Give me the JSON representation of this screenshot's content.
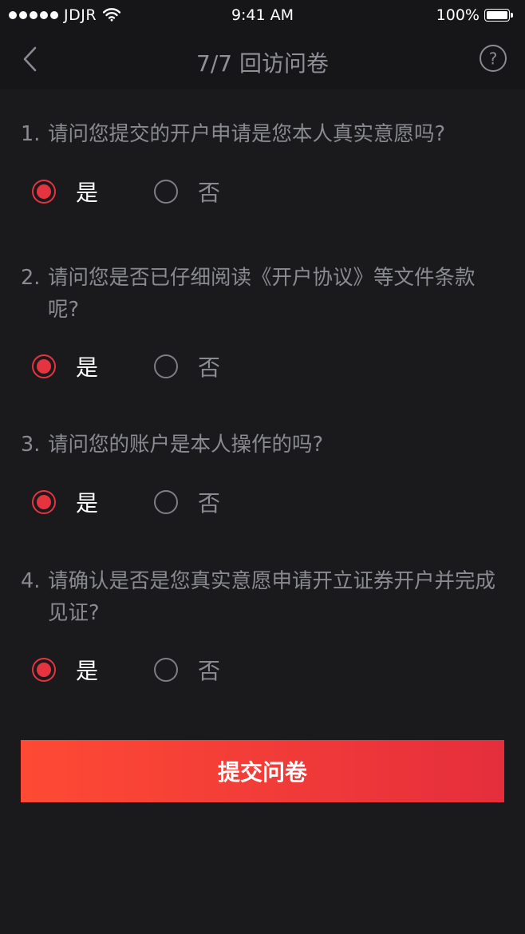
{
  "status_bar": {
    "carrier": "JDJR",
    "time": "9:41 AM",
    "battery": "100%"
  },
  "nav": {
    "title": "7/7 回访问卷",
    "help_label": "?"
  },
  "questions": [
    {
      "number": "1.",
      "text": "请问您提交的开户申请是您本人真实意愿吗?",
      "selected": "是"
    },
    {
      "number": "2.",
      "text": "请问您是否已仔细阅读《开户协议》等文件条款呢?",
      "selected": "是"
    },
    {
      "number": "3.",
      "text": "请问您的账户是本人操作的吗?",
      "selected": "是"
    },
    {
      "number": "4.",
      "text": "请确认是否是您真实意愿申请开立证券开户并完成见证?",
      "selected": "是"
    }
  ],
  "options": {
    "yes": "是",
    "no": "否"
  },
  "submit_label": "提交问卷",
  "colors": {
    "accent": "#e53440",
    "gradient_start": "#fe4a34",
    "gradient_end": "#e52e3c",
    "background": "#1a1a1c"
  }
}
